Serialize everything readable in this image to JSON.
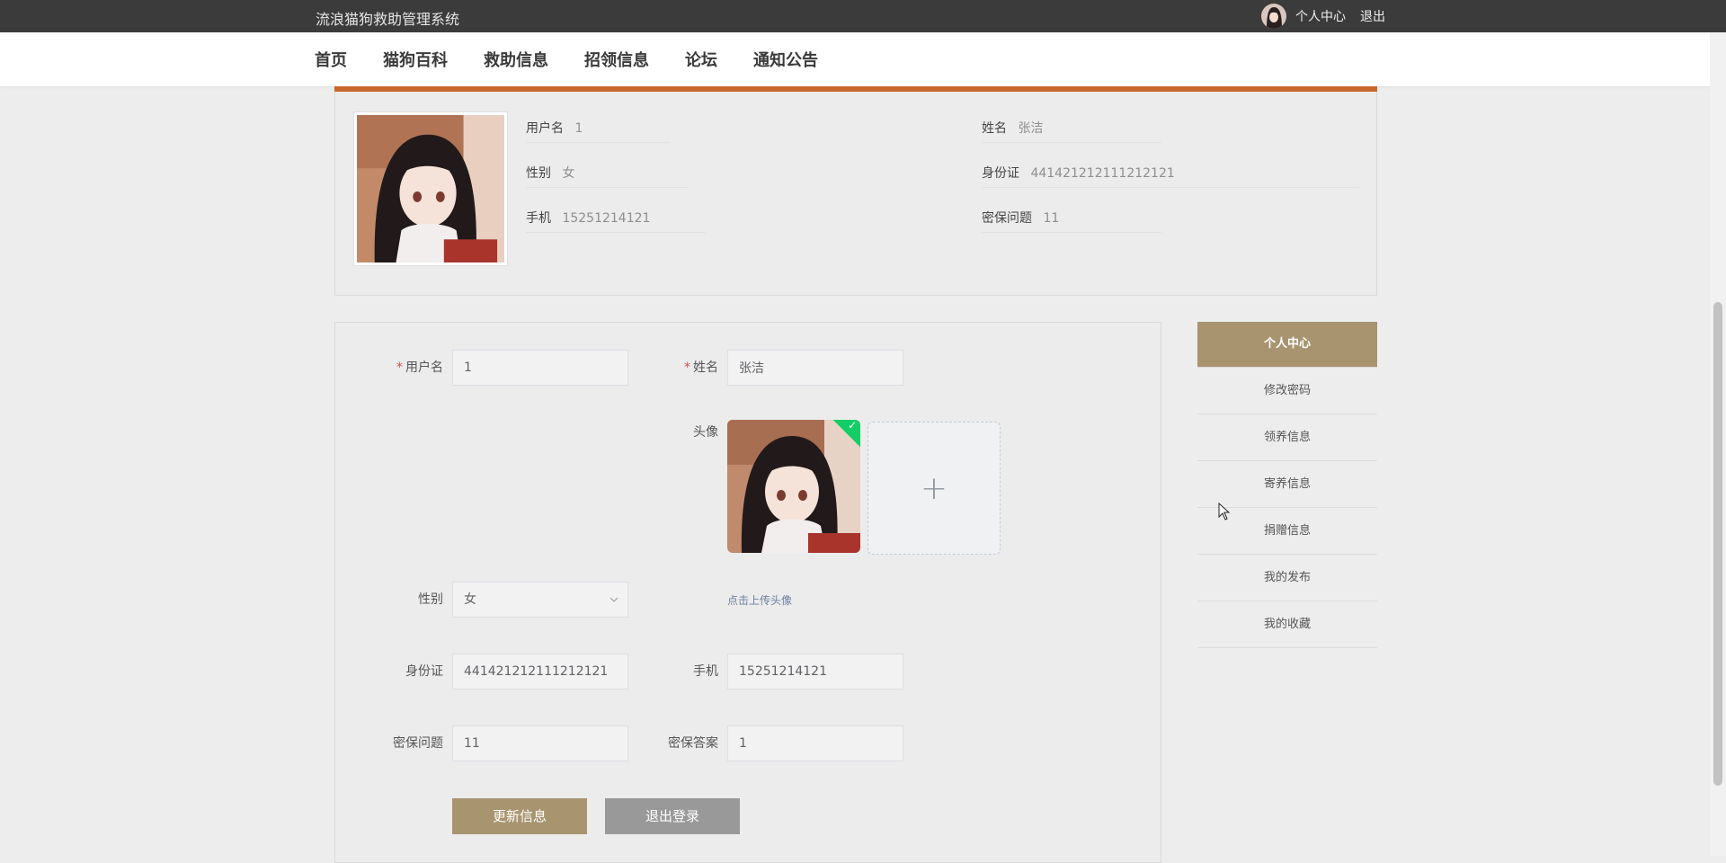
{
  "app": {
    "title": "流浪猫狗救助管理系统"
  },
  "topbar": {
    "personal_center": "个人中心",
    "logout": "退出"
  },
  "nav": {
    "items": [
      "首页",
      "猫狗百科",
      "救助信息",
      "招领信息",
      "论坛",
      "通知公告"
    ]
  },
  "theme": {
    "accent": "#c8682a",
    "primary": "#a89570",
    "secondary_button": "#999999",
    "check": "#13ce66"
  },
  "profile": {
    "username_label": "用户名",
    "username": "1",
    "name_label": "姓名",
    "name": "张洁",
    "gender_label": "性别",
    "gender": "女",
    "id_label": "身份证",
    "id_number": "441421212111212121",
    "phone_label": "手机",
    "phone": "15251214121",
    "security_q_label": "密保问题",
    "security_q": "11"
  },
  "form": {
    "username_label": "用户名",
    "username_value": "1",
    "name_label": "姓名",
    "name_value": "张洁",
    "avatar_label": "头像",
    "upload_tip": "点击上传头像",
    "upload_plus": "+",
    "gender_label": "性别",
    "gender_value": "女",
    "id_label": "身份证",
    "id_value": "441421212111212121",
    "phone_label": "手机",
    "phone_value": "15251214121",
    "security_q_label": "密保问题",
    "security_q_value": "11",
    "security_a_label": "密保答案",
    "security_a_value": "1",
    "update_button": "更新信息",
    "logout_button": "退出登录"
  },
  "side_menu": {
    "items": [
      "个人中心",
      "修改密码",
      "领养信息",
      "寄养信息",
      "捐赠信息",
      "我的发布",
      "我的收藏"
    ],
    "active_index": 0
  }
}
